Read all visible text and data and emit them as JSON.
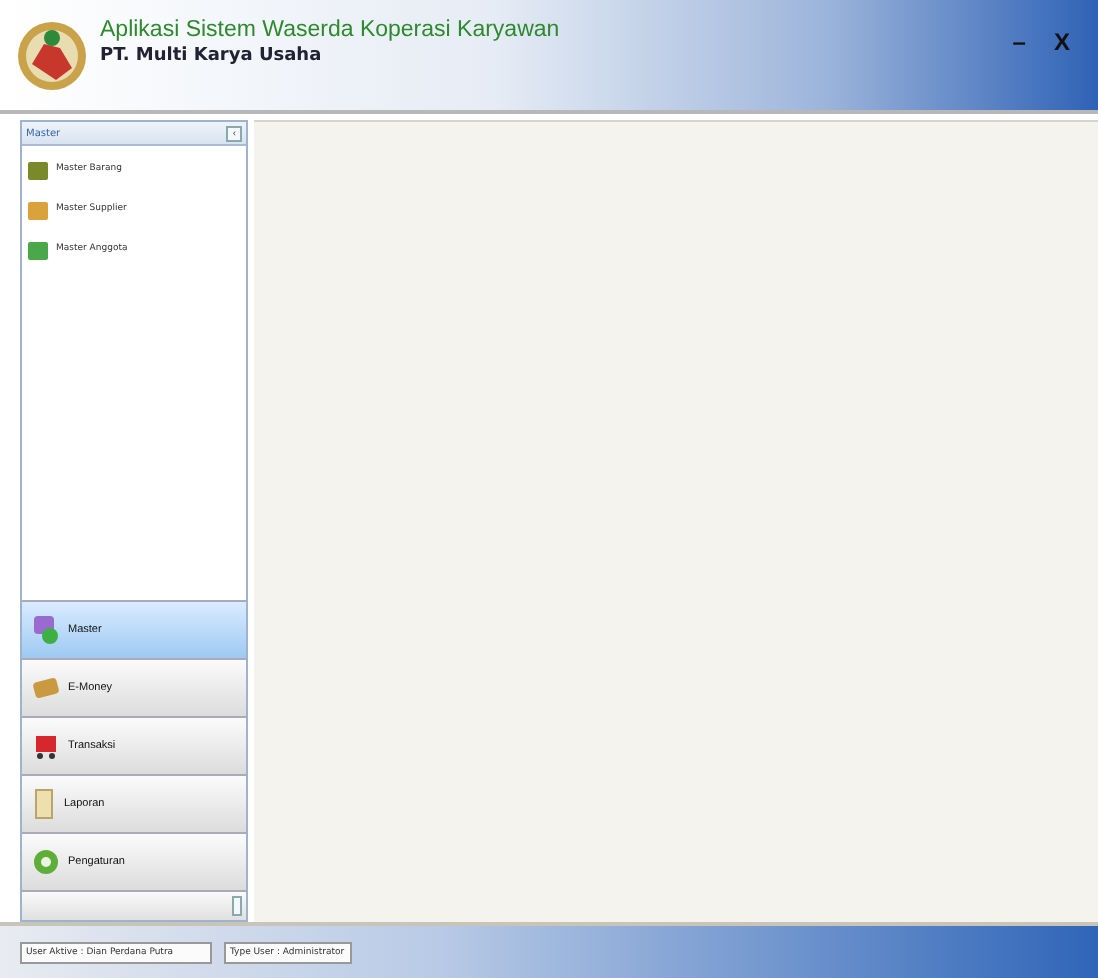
{
  "header": {
    "title": "Aplikasi Sistem Waserda Koperasi Karyawan",
    "subtitle": "PT. Multi Karya Usaha",
    "minimize": "–",
    "close": "X"
  },
  "panel": {
    "title": "Master",
    "collapse": "‹",
    "items": [
      {
        "label": "Master Barang",
        "kind": "goods"
      },
      {
        "label": "Master Supplier",
        "kind": "supplier"
      },
      {
        "label": "Master Anggota",
        "kind": "member"
      }
    ]
  },
  "nav": [
    {
      "label": "Master",
      "kind": "master",
      "selected": true
    },
    {
      "label": "E-Money",
      "kind": "money",
      "selected": false
    },
    {
      "label": "Transaksi",
      "kind": "cart",
      "selected": false
    },
    {
      "label": "Laporan",
      "kind": "report",
      "selected": false
    },
    {
      "label": "Pengaturan",
      "kind": "settings",
      "selected": false
    }
  ],
  "status": [
    "User Aktive : Dian Perdana Putra",
    "Type User : Administrator"
  ]
}
